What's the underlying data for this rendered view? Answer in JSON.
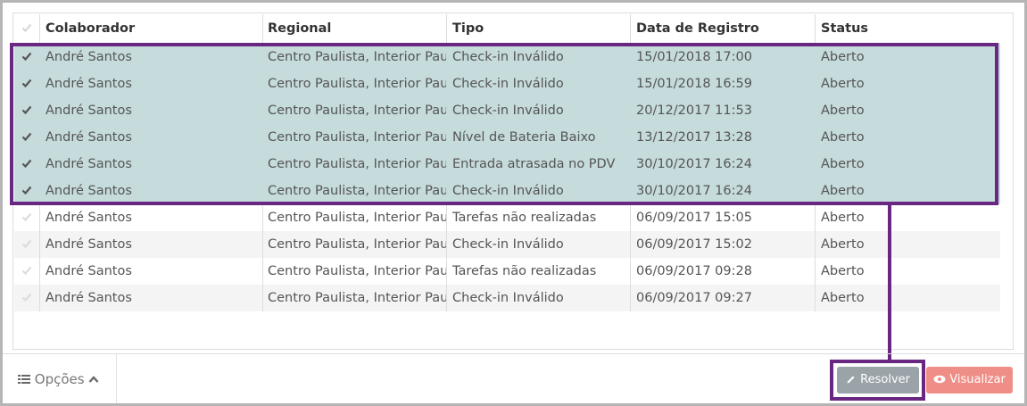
{
  "table": {
    "columns": [
      "Colaborador",
      "Regional",
      "Tipo",
      "Data de Registro",
      "Status"
    ],
    "rows": [
      {
        "selected": true,
        "colaborador": "André Santos",
        "regional": "Centro Paulista, Interior Paulista",
        "tipo": "Check-in Inválido",
        "data": "15/01/2018 17:00",
        "status": "Aberto"
      },
      {
        "selected": true,
        "colaborador": "André Santos",
        "regional": "Centro Paulista, Interior Paulista",
        "tipo": "Check-in Inválido",
        "data": "15/01/2018 16:59",
        "status": "Aberto"
      },
      {
        "selected": true,
        "colaborador": "André Santos",
        "regional": "Centro Paulista, Interior Paulista",
        "tipo": "Check-in Inválido",
        "data": "20/12/2017 11:53",
        "status": "Aberto"
      },
      {
        "selected": true,
        "colaborador": "André Santos",
        "regional": "Centro Paulista, Interior Paulista",
        "tipo": "Nível de Bateria Baixo",
        "data": "13/12/2017 13:28",
        "status": "Aberto"
      },
      {
        "selected": true,
        "colaborador": "André Santos",
        "regional": "Centro Paulista, Interior Paulista",
        "tipo": "Entrada atrasada no PDV",
        "data": "30/10/2017 16:24",
        "status": "Aberto"
      },
      {
        "selected": true,
        "colaborador": "André Santos",
        "regional": "Centro Paulista, Interior Paulista",
        "tipo": "Check-in Inválido",
        "data": "30/10/2017 16:24",
        "status": "Aberto"
      },
      {
        "selected": false,
        "colaborador": "André Santos",
        "regional": "Centro Paulista, Interior Paulista",
        "tipo": "Tarefas não realizadas",
        "data": "06/09/2017 15:05",
        "status": "Aberto"
      },
      {
        "selected": false,
        "colaborador": "André Santos",
        "regional": "Centro Paulista, Interior Paulista",
        "tipo": "Check-in Inválido",
        "data": "06/09/2017 15:02",
        "status": "Aberto"
      },
      {
        "selected": false,
        "colaborador": "André Santos",
        "regional": "Centro Paulista, Interior Paulista",
        "tipo": "Tarefas não realizadas",
        "data": "06/09/2017 09:28",
        "status": "Aberto"
      },
      {
        "selected": false,
        "colaborador": "André Santos",
        "regional": "Centro Paulista, Interior Paulista",
        "tipo": "Check-in Inválido",
        "data": "06/09/2017 09:27",
        "status": "Aberto"
      }
    ]
  },
  "footer": {
    "options_label": "Opções",
    "resolver_label": "Resolver",
    "visualizar_label": "Visualizar"
  },
  "colors": {
    "selected_row": "#c6dbdc",
    "highlight": "#6a2782",
    "resolver_button": "#9aa3a8",
    "visualizar_button": "#ef8e86"
  },
  "icons": {
    "row_check": "check-icon",
    "options": "list-icon",
    "options_toggle": "chevron-up-icon",
    "resolver": "pencil-icon",
    "visualizar": "eye-icon"
  }
}
